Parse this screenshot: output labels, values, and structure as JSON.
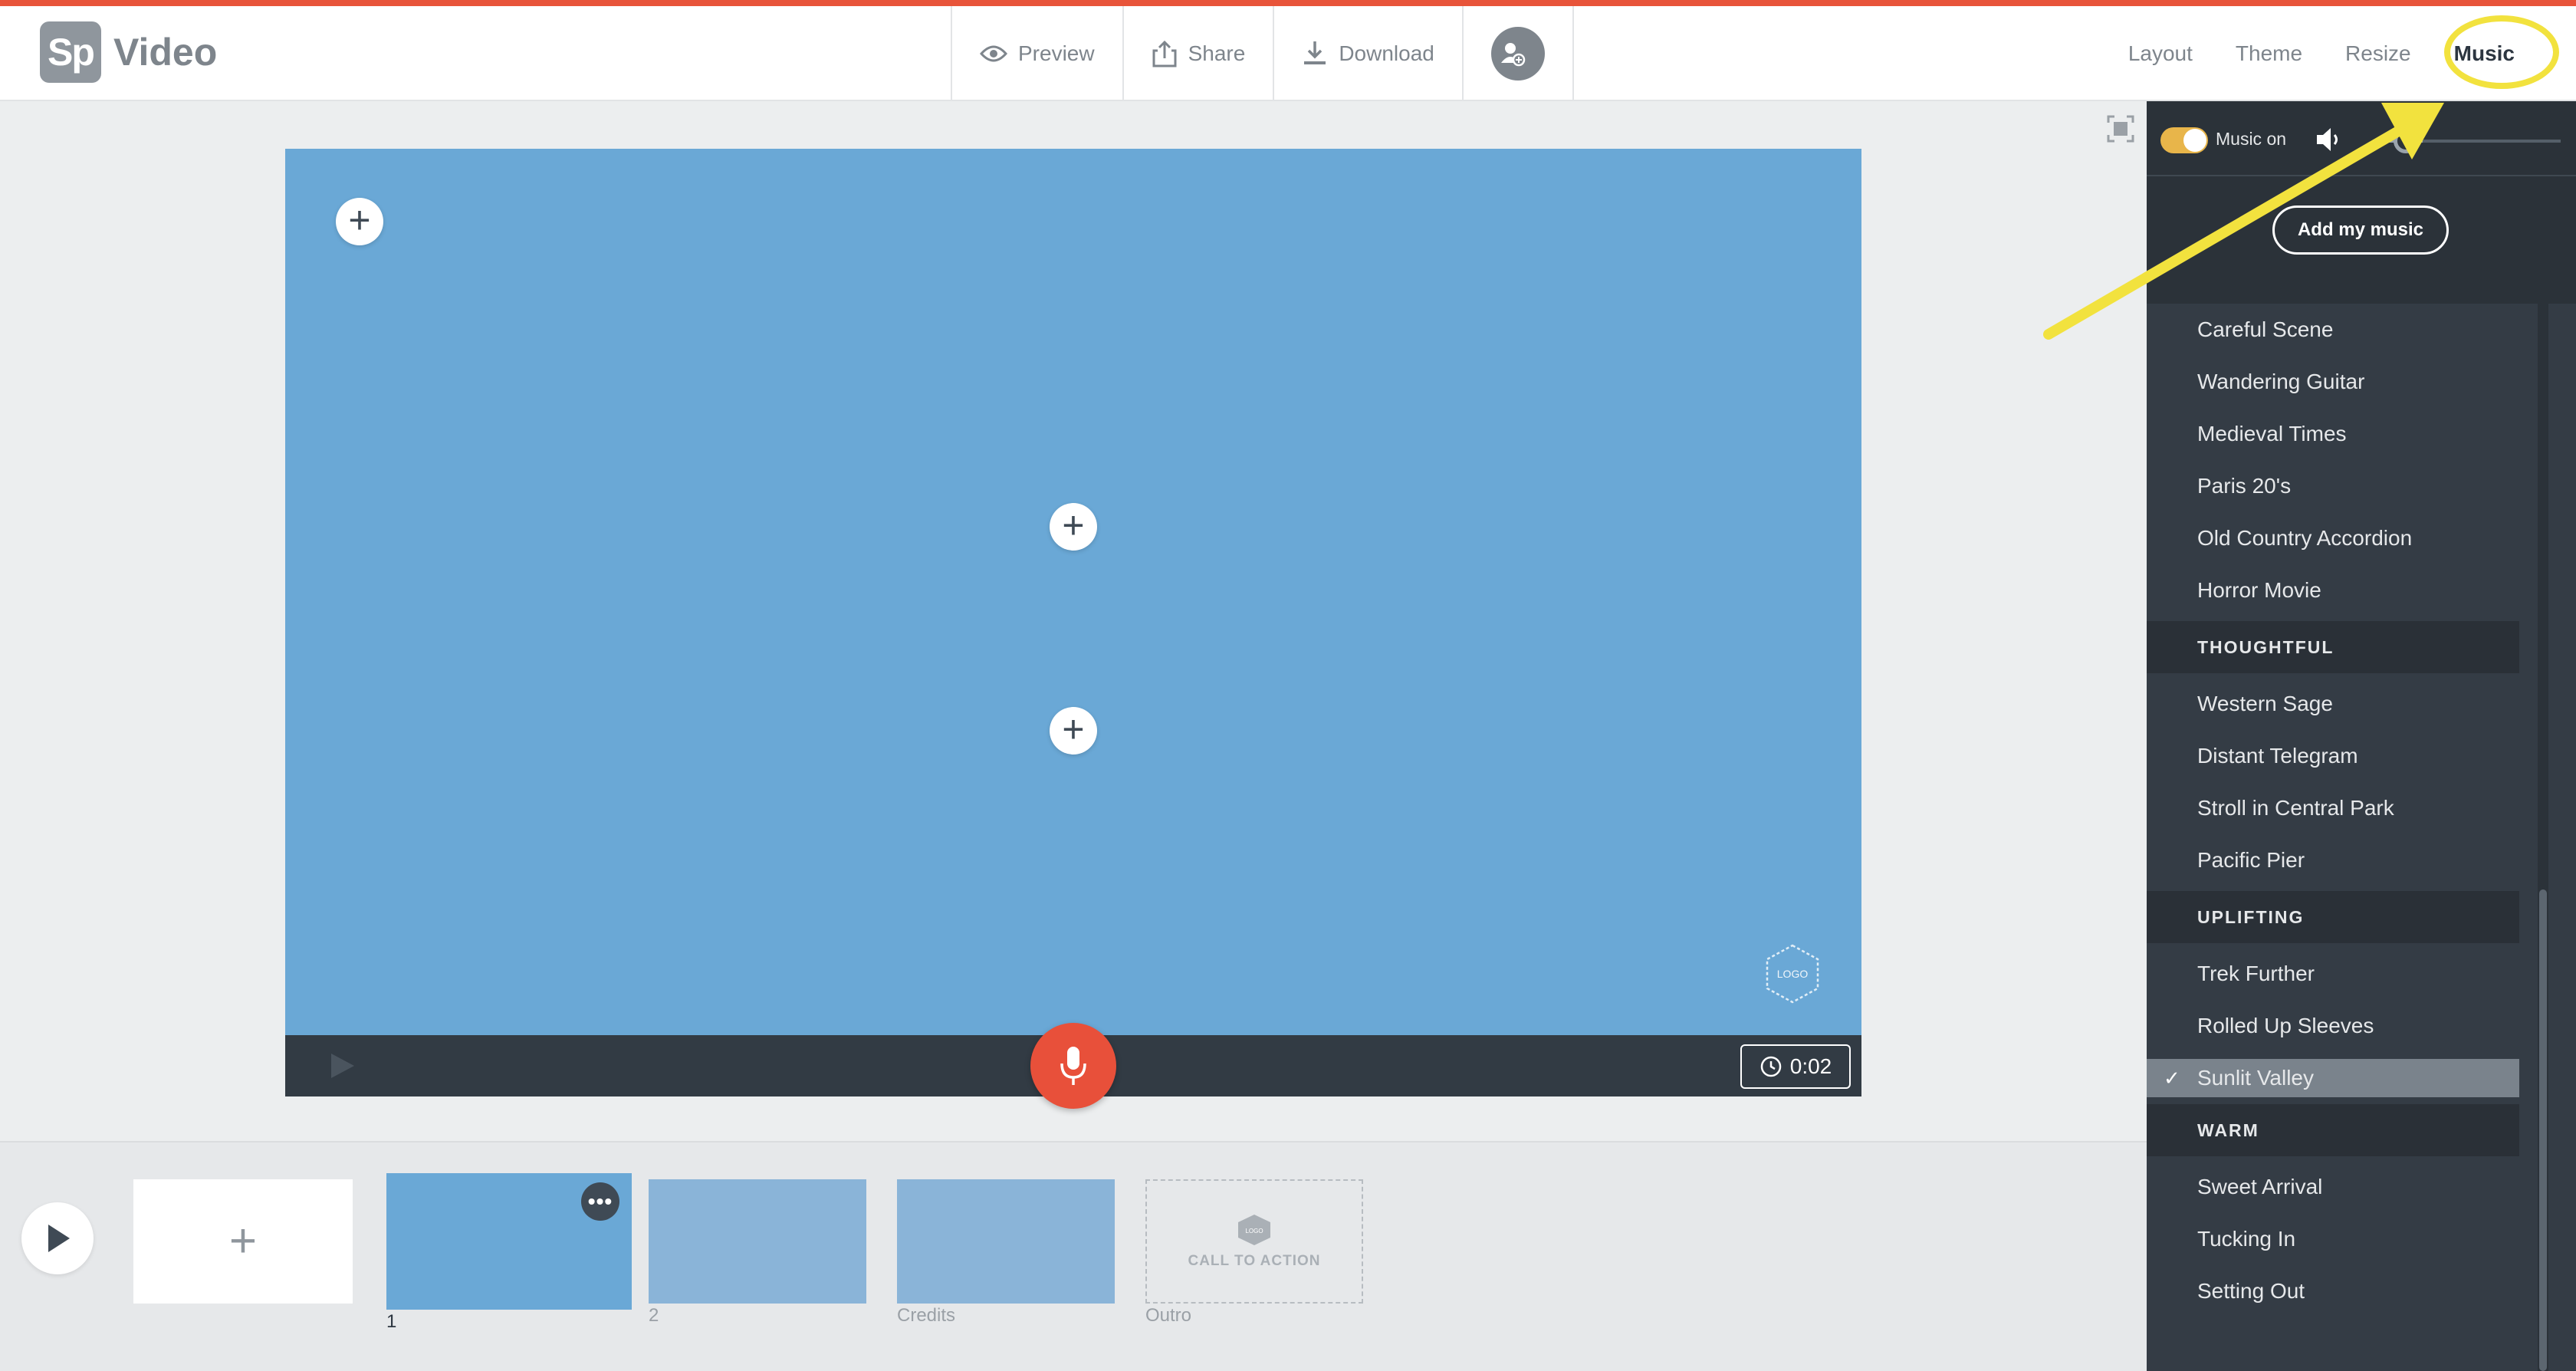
{
  "app": {
    "logo_mark": "Sp",
    "logo_text": "Video"
  },
  "toolbar": {
    "preview_label": "Preview",
    "share_label": "Share",
    "download_label": "Download"
  },
  "tabs": [
    {
      "label": "Layout"
    },
    {
      "label": "Theme"
    },
    {
      "label": "Resize"
    },
    {
      "label": "Music",
      "active": true
    }
  ],
  "stage": {
    "logo_placeholder": "LOGO",
    "timer": "0:02"
  },
  "timeline": {
    "scenes": [
      {
        "label": "1"
      },
      {
        "label": "2"
      },
      {
        "label": "Credits"
      },
      {
        "label": "Outro"
      }
    ],
    "more_glyph": "•••",
    "cta_label": "CALL TO ACTION",
    "cta_logo": "LOGO"
  },
  "music_panel": {
    "toggle_label": "Music on",
    "music_enabled": true,
    "volume_level": 0.25,
    "add_music_label": "Add my music",
    "tracks_top": [
      "Careful Scene",
      "Wandering Guitar",
      "Medieval Times",
      "Paris 20's",
      "Old Country Accordion",
      "Horror Movie"
    ],
    "categories": [
      {
        "name": "THOUGHTFUL",
        "tracks": [
          "Western Sage",
          "Distant Telegram",
          "Stroll in Central Park",
          "Pacific Pier"
        ]
      },
      {
        "name": "UPLIFTING",
        "tracks": [
          "Trek Further",
          "Rolled Up Sleeves",
          "Sunlit Valley"
        ]
      },
      {
        "name": "WARM",
        "tracks": [
          "Sweet Arrival",
          "Tucking In",
          "Setting Out"
        ]
      }
    ],
    "selected_track": "Sunlit Valley",
    "check_glyph": "✓"
  },
  "colors": {
    "accent_red": "#e8503a",
    "canvas_blue": "#6aa8d6",
    "annotation_yellow": "#f2e23e",
    "toggle_on": "#e8b54a"
  }
}
